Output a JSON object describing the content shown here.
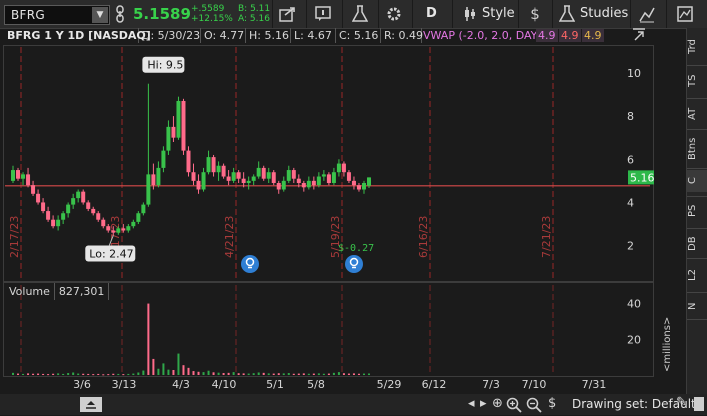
{
  "toolbar": {
    "symbol": "BFRG",
    "last_price": "5.1589",
    "change_abs": "+.5589",
    "change_pct": "+12.15%",
    "bid": "B: 5.11",
    "ask": "A: 5.16",
    "aggregation_label": "D",
    "style_label": "Style",
    "studies_label": "Studies"
  },
  "header": {
    "title": "BFRG 1 Y 1D [NASDAQ]",
    "date": "D: 5/30/23",
    "open": "O: 4.77",
    "high": "H: 5.16",
    "low": "L: 4.67",
    "close": "C: 5.16",
    "range": "R: 0.49",
    "vwap_label": "VWAP (-2.0, 2.0, DAY)",
    "vwap_values": [
      "4.9",
      "4.9",
      "4.9"
    ],
    "vwap_colors": [
      "#e377e3",
      "#ff6666",
      "#e6b84a"
    ]
  },
  "right_tabs": [
    "Trd",
    "TS",
    "AT",
    "Btns",
    "C",
    "PS",
    "DB",
    "L2",
    "N"
  ],
  "volume_panel": {
    "label": "Volume",
    "value": "827,301",
    "axis_unit": "<millions>"
  },
  "bottom_bar": {
    "drawing_set": "Drawing set: Default"
  },
  "chart_data": {
    "type": "candlestick",
    "price_axis": {
      "ylim": [
        0.5,
        11.2
      ],
      "ticks": [
        2,
        4,
        6,
        8,
        10
      ]
    },
    "volume_axis": {
      "ylim": [
        0,
        42
      ],
      "ticks": [
        20,
        40
      ],
      "unit": "millions"
    },
    "x_ticks": [
      "3/6",
      "3/13",
      "4/3",
      "4/10",
      "5/1",
      "5/8",
      "5/29",
      "6/12",
      "7/3",
      "7/10",
      "7/31"
    ],
    "event_markers": [
      "2/17/23",
      "3/17/23",
      "4/21/23",
      "5/19/23",
      "6/16/23",
      "7/21/23"
    ],
    "annotations": {
      "high": "Hi: 9.5",
      "low": "Lo: 2.47",
      "earnings": "$-0.27"
    },
    "last_price_label": "5.16",
    "last_price": 5.16,
    "price_line": 4.77,
    "colors": {
      "up": "#39c24b",
      "down": "#ff6b8a",
      "grid": "#b02a2a",
      "price_line": "#d84a4a",
      "volume": "#2fa84a"
    },
    "candles": [
      {
        "o": 5.0,
        "h": 5.7,
        "l": 4.9,
        "c": 5.5
      },
      {
        "o": 5.5,
        "h": 5.6,
        "l": 5.0,
        "c": 5.1
      },
      {
        "o": 5.1,
        "h": 5.4,
        "l": 4.8,
        "c": 5.3
      },
      {
        "o": 5.3,
        "h": 5.6,
        "l": 4.7,
        "c": 4.8
      },
      {
        "o": 4.8,
        "h": 5.0,
        "l": 4.3,
        "c": 4.4
      },
      {
        "o": 4.4,
        "h": 4.6,
        "l": 3.9,
        "c": 4.0
      },
      {
        "o": 4.0,
        "h": 4.2,
        "l": 3.5,
        "c": 3.6
      },
      {
        "o": 3.6,
        "h": 3.8,
        "l": 3.1,
        "c": 3.2
      },
      {
        "o": 3.2,
        "h": 3.4,
        "l": 2.8,
        "c": 2.9
      },
      {
        "o": 2.9,
        "h": 3.4,
        "l": 2.7,
        "c": 3.2
      },
      {
        "o": 3.2,
        "h": 3.6,
        "l": 3.0,
        "c": 3.5
      },
      {
        "o": 3.5,
        "h": 4.0,
        "l": 3.3,
        "c": 3.9
      },
      {
        "o": 3.9,
        "h": 4.4,
        "l": 3.7,
        "c": 4.2
      },
      {
        "o": 4.2,
        "h": 4.6,
        "l": 4.0,
        "c": 4.5
      },
      {
        "o": 4.5,
        "h": 4.6,
        "l": 3.9,
        "c": 4.0
      },
      {
        "o": 4.0,
        "h": 4.1,
        "l": 3.6,
        "c": 3.7
      },
      {
        "o": 3.7,
        "h": 3.8,
        "l": 3.4,
        "c": 3.5
      },
      {
        "o": 3.5,
        "h": 3.6,
        "l": 3.1,
        "c": 3.2
      },
      {
        "o": 3.2,
        "h": 3.3,
        "l": 2.8,
        "c": 2.9
      },
      {
        "o": 2.9,
        "h": 3.0,
        "l": 2.6,
        "c": 2.7
      },
      {
        "o": 2.7,
        "h": 2.9,
        "l": 2.47,
        "c": 2.6
      },
      {
        "o": 2.6,
        "h": 2.9,
        "l": 2.5,
        "c": 2.8
      },
      {
        "o": 2.8,
        "h": 3.0,
        "l": 2.6,
        "c": 2.7
      },
      {
        "o": 2.7,
        "h": 3.0,
        "l": 2.6,
        "c": 2.9
      },
      {
        "o": 2.9,
        "h": 3.2,
        "l": 2.8,
        "c": 3.1
      },
      {
        "o": 3.1,
        "h": 3.6,
        "l": 3.0,
        "c": 3.5
      },
      {
        "o": 3.5,
        "h": 4.0,
        "l": 3.4,
        "c": 3.9
      },
      {
        "o": 3.9,
        "h": 9.5,
        "l": 3.8,
        "c": 5.3
      },
      {
        "o": 5.3,
        "h": 5.8,
        "l": 4.6,
        "c": 4.8
      },
      {
        "o": 4.8,
        "h": 5.9,
        "l": 4.7,
        "c": 5.6
      },
      {
        "o": 5.6,
        "h": 6.6,
        "l": 5.4,
        "c": 6.4
      },
      {
        "o": 6.4,
        "h": 7.8,
        "l": 6.2,
        "c": 7.5
      },
      {
        "o": 7.5,
        "h": 8.0,
        "l": 6.8,
        "c": 7.0
      },
      {
        "o": 7.0,
        "h": 8.9,
        "l": 6.9,
        "c": 8.7
      },
      {
        "o": 8.7,
        "h": 8.8,
        "l": 6.2,
        "c": 6.4
      },
      {
        "o": 6.4,
        "h": 6.6,
        "l": 5.2,
        "c": 5.4
      },
      {
        "o": 5.4,
        "h": 5.8,
        "l": 4.8,
        "c": 5.0
      },
      {
        "o": 5.0,
        "h": 5.3,
        "l": 4.4,
        "c": 4.6
      },
      {
        "o": 4.6,
        "h": 5.6,
        "l": 4.5,
        "c": 5.4
      },
      {
        "o": 5.4,
        "h": 6.4,
        "l": 5.3,
        "c": 6.1
      },
      {
        "o": 6.1,
        "h": 6.2,
        "l": 5.2,
        "c": 5.4
      },
      {
        "o": 5.4,
        "h": 5.9,
        "l": 5.0,
        "c": 5.7
      },
      {
        "o": 5.7,
        "h": 5.8,
        "l": 5.1,
        "c": 5.2
      },
      {
        "o": 5.2,
        "h": 5.5,
        "l": 4.8,
        "c": 5.0
      },
      {
        "o": 5.0,
        "h": 5.6,
        "l": 4.9,
        "c": 5.4
      },
      {
        "o": 5.4,
        "h": 5.5,
        "l": 4.9,
        "c": 5.1
      },
      {
        "o": 5.1,
        "h": 5.4,
        "l": 4.7,
        "c": 4.9
      },
      {
        "o": 4.9,
        "h": 5.2,
        "l": 4.6,
        "c": 5.0
      },
      {
        "o": 5.0,
        "h": 5.3,
        "l": 4.8,
        "c": 5.2
      },
      {
        "o": 5.2,
        "h": 5.9,
        "l": 5.1,
        "c": 5.6
      },
      {
        "o": 5.6,
        "h": 5.7,
        "l": 5.0,
        "c": 5.1
      },
      {
        "o": 5.1,
        "h": 5.6,
        "l": 4.9,
        "c": 5.4
      },
      {
        "o": 5.4,
        "h": 5.5,
        "l": 4.8,
        "c": 4.9
      },
      {
        "o": 4.9,
        "h": 5.0,
        "l": 4.4,
        "c": 4.6
      },
      {
        "o": 4.6,
        "h": 5.2,
        "l": 4.5,
        "c": 5.0
      },
      {
        "o": 5.0,
        "h": 5.7,
        "l": 4.9,
        "c": 5.5
      },
      {
        "o": 5.5,
        "h": 5.6,
        "l": 4.9,
        "c": 5.1
      },
      {
        "o": 5.1,
        "h": 5.3,
        "l": 4.7,
        "c": 4.9
      },
      {
        "o": 4.9,
        "h": 5.0,
        "l": 4.5,
        "c": 4.7
      },
      {
        "o": 4.7,
        "h": 5.2,
        "l": 4.6,
        "c": 5.0
      },
      {
        "o": 5.0,
        "h": 5.2,
        "l": 4.6,
        "c": 4.8
      },
      {
        "o": 4.8,
        "h": 5.4,
        "l": 4.7,
        "c": 5.2
      },
      {
        "o": 5.2,
        "h": 5.5,
        "l": 5.0,
        "c": 5.3
      },
      {
        "o": 5.3,
        "h": 5.4,
        "l": 4.8,
        "c": 4.9
      },
      {
        "o": 4.9,
        "h": 5.6,
        "l": 4.8,
        "c": 5.4
      },
      {
        "o": 5.4,
        "h": 6.0,
        "l": 5.2,
        "c": 5.8
      },
      {
        "o": 5.8,
        "h": 5.9,
        "l": 5.2,
        "c": 5.4
      },
      {
        "o": 5.4,
        "h": 5.5,
        "l": 4.9,
        "c": 5.0
      },
      {
        "o": 5.0,
        "h": 5.2,
        "l": 4.6,
        "c": 4.8
      },
      {
        "o": 4.8,
        "h": 4.9,
        "l": 4.5,
        "c": 4.6
      },
      {
        "o": 4.6,
        "h": 5.0,
        "l": 4.4,
        "c": 4.9
      },
      {
        "o": 4.77,
        "h": 5.16,
        "l": 4.67,
        "c": 5.16
      }
    ],
    "volumes": [
      1.2,
      0.8,
      0.6,
      0.9,
      0.7,
      0.8,
      0.6,
      0.5,
      0.7,
      0.9,
      0.6,
      1.1,
      1.4,
      0.8,
      0.7,
      0.6,
      0.5,
      0.6,
      0.4,
      0.5,
      0.7,
      0.6,
      0.5,
      0.6,
      0.8,
      1.4,
      2.5,
      40.0,
      9.0,
      3.5,
      6.5,
      3.0,
      2.8,
      12.0,
      5.5,
      4.0,
      2.2,
      1.8,
      1.6,
      2.4,
      1.5,
      1.3,
      1.1,
      1.2,
      1.6,
      1.0,
      0.9,
      0.8,
      1.0,
      1.4,
      1.2,
      0.9,
      0.8,
      1.0,
      0.9,
      1.1,
      0.7,
      0.8,
      0.9,
      0.7,
      0.8,
      0.9,
      0.7,
      0.8,
      1.2,
      1.6,
      1.0,
      0.8,
      0.9,
      0.7,
      0.8,
      0.827
    ]
  }
}
